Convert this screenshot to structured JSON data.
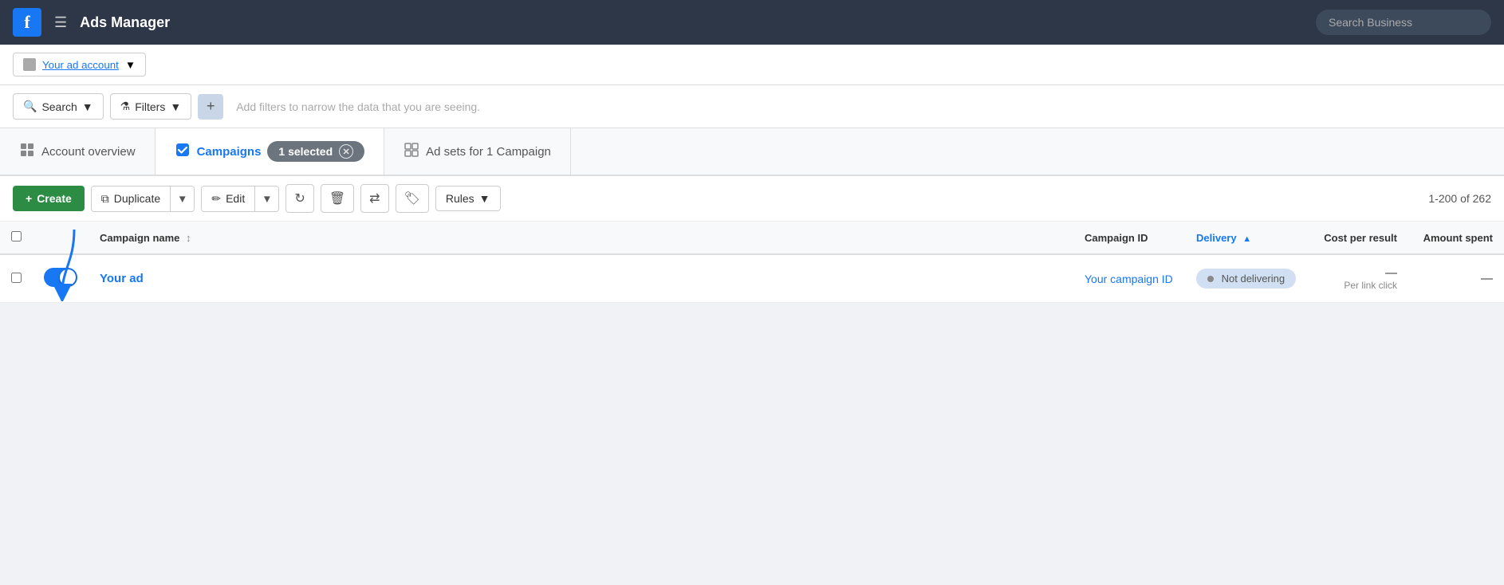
{
  "nav": {
    "title": "Ads Manager",
    "search_placeholder": "Search Business"
  },
  "account_selector": {
    "text": "Your ad account",
    "dropdown_icon": "▼"
  },
  "filter_bar": {
    "search_label": "Search",
    "filters_label": "Filters",
    "add_icon": "+",
    "hint_text": "Add filters to narrow the data that you are seeing."
  },
  "tabs": [
    {
      "id": "account-overview",
      "label": "Account overview",
      "active": false
    },
    {
      "id": "campaigns",
      "label": "Campaigns",
      "active": true
    },
    {
      "id": "ad-sets",
      "label": "Ad sets for 1 Campaign",
      "active": false
    }
  ],
  "selected_badge": {
    "text": "1 selected",
    "close_icon": "✕"
  },
  "toolbar": {
    "create_label": "+ Create",
    "duplicate_label": "Duplicate",
    "edit_label": "Edit",
    "rules_label": "Rules",
    "pagination": "1-200 of 262"
  },
  "table": {
    "headers": [
      {
        "id": "campaign-name",
        "label": "Campaign name",
        "sortable": true,
        "sorted": false
      },
      {
        "id": "campaign-id",
        "label": "Campaign ID",
        "sortable": false,
        "sorted": false
      },
      {
        "id": "delivery",
        "label": "Delivery",
        "sortable": true,
        "sorted": true
      },
      {
        "id": "cost-per-result",
        "label": "Cost per result",
        "sortable": false,
        "sorted": false
      },
      {
        "id": "amount-spent",
        "label": "Amount spent",
        "sortable": false,
        "sorted": false
      }
    ],
    "rows": [
      {
        "campaign_name": "Your ad",
        "campaign_id": "Your campaign ID",
        "delivery_status": "Not delivering",
        "cost_per_result": "—",
        "cost_sub": "Per link click",
        "amount_spent": "—",
        "toggle_on": true
      }
    ]
  }
}
